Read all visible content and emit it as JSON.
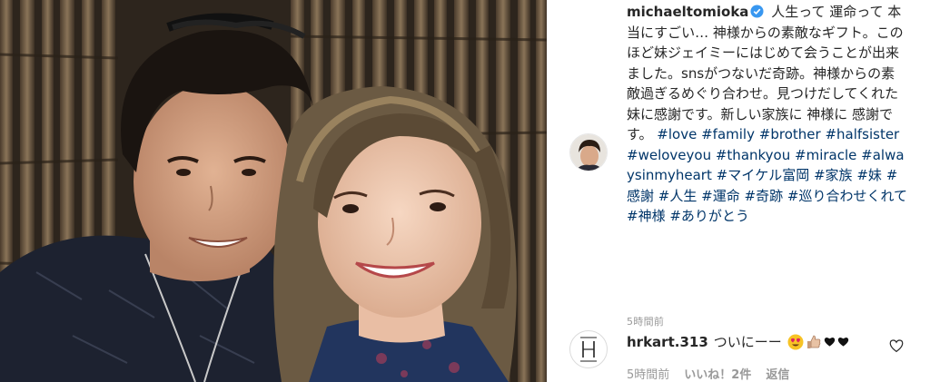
{
  "post": {
    "username": "michaeltomioka",
    "caption_text": "人生って 運命って 本当にすごい… 神様からの素敵なギフト。このほど妹ジェイミーにはじめて会うことが出来ました。snsがつないだ奇跡。神様からの素敵過ぎるめぐり合わせ。見つけだしてくれた妹に感謝です。新しい家族に 神様に 感謝です。",
    "hashtags": [
      "#love",
      "#family",
      "#brother",
      "#halfsister",
      "#weloveyou",
      "#thankyou",
      "#miracle",
      "#alwaysinmyheart",
      "#マイケル富岡",
      "#家族",
      "#妹",
      "#感謝",
      "#人生",
      "#運命",
      "#奇跡",
      "#巡り合わせくれて",
      "#神様",
      "#ありがとう"
    ],
    "time": "5時間前"
  },
  "comment": {
    "username": "hrkart.313",
    "text": "ついにーー",
    "emojis": [
      "heart-eyes-emoji",
      "thumbs-up-emoji",
      "black-heart",
      "black-heart"
    ],
    "time": "5時間前",
    "likes": "いいね！2件",
    "reply": "返信"
  },
  "icons": {
    "verified": "verified-badge-icon",
    "like": "heart-outline-icon"
  },
  "colors": {
    "hashtag": "#003569",
    "meta": "#999999",
    "verified": "#3897f0"
  }
}
